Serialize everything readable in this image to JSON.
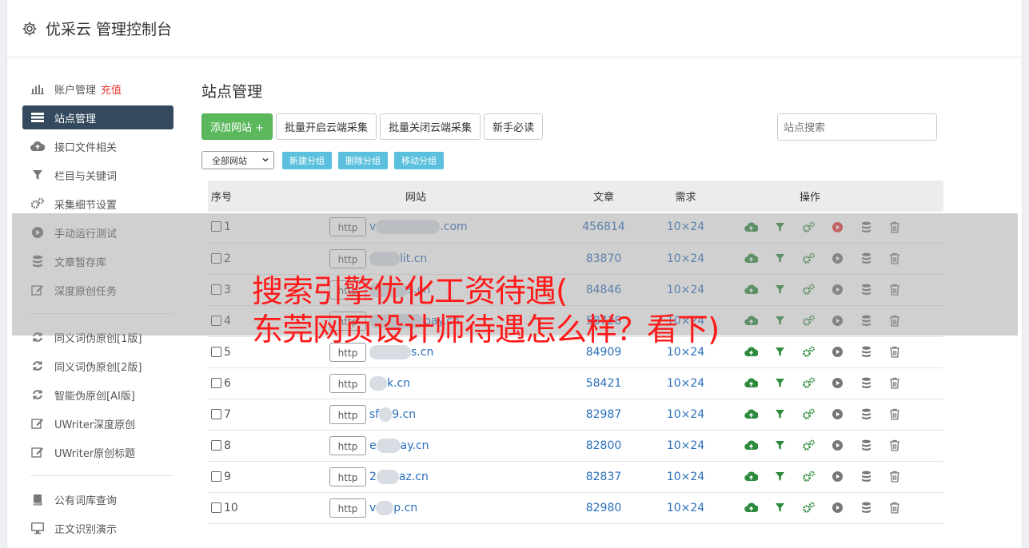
{
  "app": {
    "title": "优采云 管理控制台"
  },
  "sidebar": {
    "items": [
      {
        "label": "账户管理",
        "extra": "充值",
        "icon": "bar-chart-icon"
      },
      {
        "label": "站点管理",
        "icon": "server-icon",
        "active": true
      },
      {
        "label": "接口文件相关",
        "icon": "cloud-upload-icon"
      },
      {
        "label": "栏目与关键词",
        "icon": "filter-icon"
      },
      {
        "label": "采集细节设置",
        "icon": "cogs-icon"
      },
      {
        "label": "手动运行测试",
        "icon": "play-circle-icon"
      },
      {
        "label": "文章暂存库",
        "icon": "database-icon"
      },
      {
        "label": "深度原创任务",
        "icon": "edit-icon"
      }
    ],
    "items2": [
      {
        "label": "同义词伪原创[1版]",
        "icon": "refresh-icon"
      },
      {
        "label": "同义词伪原创[2版]",
        "icon": "refresh-icon"
      },
      {
        "label": "智能伪原创[AI版]",
        "icon": "refresh-icon"
      },
      {
        "label": "UWriter深度原创",
        "icon": "edit-icon"
      },
      {
        "label": "UWriter原创标题",
        "icon": "edit-icon"
      }
    ],
    "items3": [
      {
        "label": "公有词库查询",
        "icon": "book-icon"
      },
      {
        "label": "正文识别演示",
        "icon": "monitor-icon"
      }
    ]
  },
  "main": {
    "title": "站点管理",
    "add_button": "添加网站 +",
    "batch_on": "批量开启云端采集",
    "batch_off": "批量关闭云端采集",
    "guide": "新手必读",
    "search_placeholder": "站点搜索",
    "group_select": "全部网站",
    "new_group": "新建分组",
    "delete_group": "删除分组",
    "move_group": "移动分组"
  },
  "table": {
    "headers": [
      "序号",
      "网站",
      "文章",
      "需求",
      "操作"
    ],
    "http_label": "http",
    "rows": [
      {
        "no": "1",
        "site_prefix": "v",
        "site_suffix": ".com",
        "articles": "456814",
        "need": "10×24",
        "run_active": true
      },
      {
        "no": "2",
        "site_prefix": "",
        "site_suffix": "lit.cn",
        "articles": "83870",
        "need": "10×24"
      },
      {
        "no": "3",
        "site_prefix": "",
        "site_suffix": "s.cn",
        "articles": "84846",
        "need": "10×24"
      },
      {
        "no": "4",
        "site_prefix": "",
        "site_suffix": "pay.cn",
        "articles": "58728",
        "need": "10×24"
      },
      {
        "no": "5",
        "site_prefix": "",
        "site_suffix": "s.cn",
        "articles": "84909",
        "need": "10×24"
      },
      {
        "no": "6",
        "site_prefix": "",
        "site_suffix": "k.cn",
        "articles": "58421",
        "need": "10×24"
      },
      {
        "no": "7",
        "site_prefix": "sf",
        "site_suffix": "9.cn",
        "articles": "82987",
        "need": "10×24"
      },
      {
        "no": "8",
        "site_prefix": "e",
        "site_suffix": "ay.cn",
        "articles": "82800",
        "need": "10×24"
      },
      {
        "no": "9",
        "site_prefix": "2",
        "site_suffix": "az.cn",
        "articles": "82837",
        "need": "10×24"
      },
      {
        "no": "10",
        "site_prefix": "v",
        "site_suffix": "p.cn",
        "articles": "82980",
        "need": "10×24"
      }
    ]
  },
  "overlay": {
    "line1": "搜索引擎优化工资待遇(",
    "line2": "东莞网页设计师待遇怎么样？看下)"
  },
  "colors": {
    "green": "#5cb85c",
    "info": "#5bc0de",
    "nav_active": "#34495e",
    "link": "#2a6ebb",
    "red": "#ff1a1a"
  }
}
